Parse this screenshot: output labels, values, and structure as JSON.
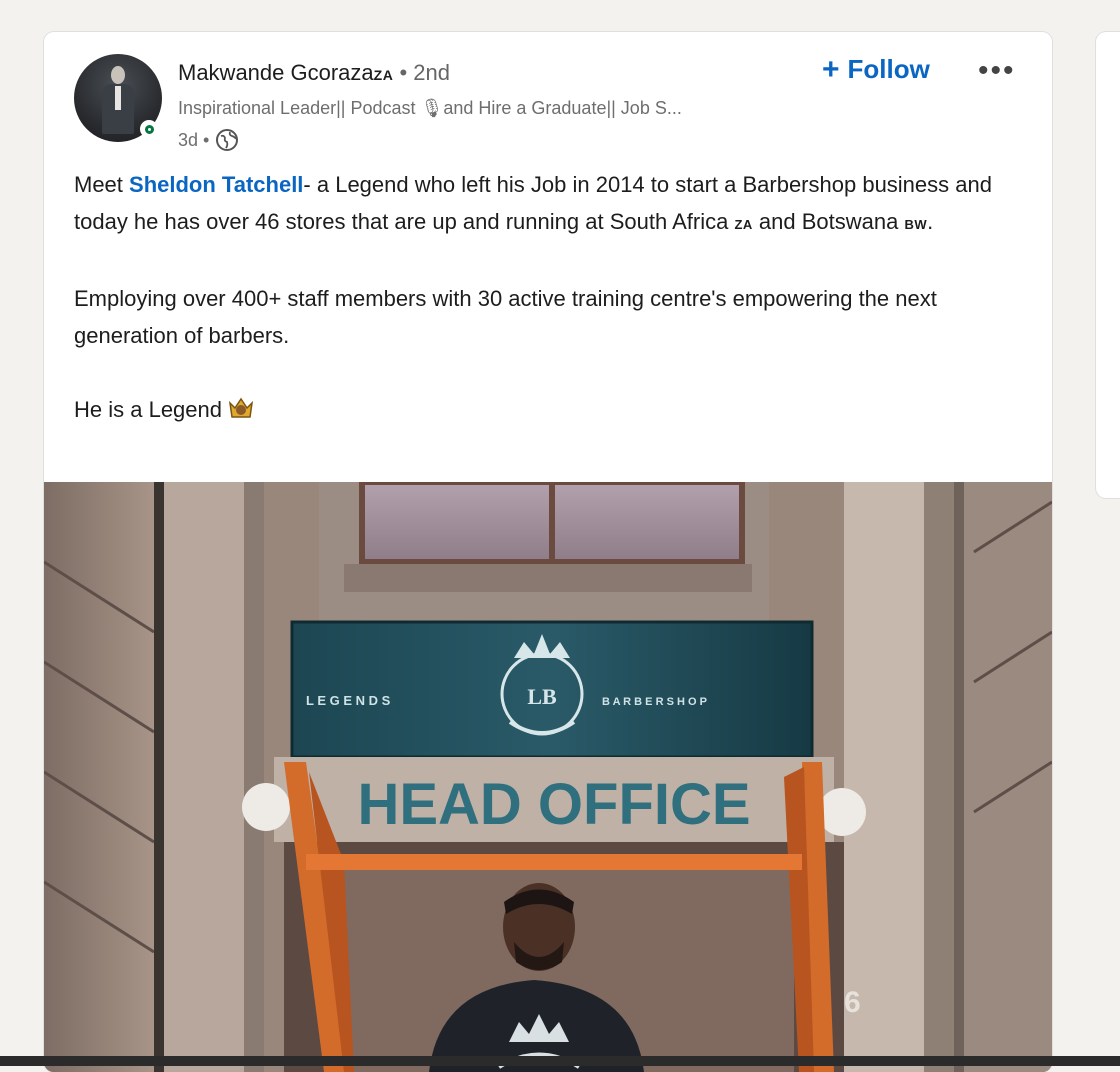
{
  "post": {
    "author": {
      "name": "Makwande Gcoraza",
      "name_suffix": "ZA",
      "separator": "•",
      "degree": "2nd",
      "headline": "Inspirational Leader|| Podcast 🎙and Hire a Graduate|| Job S...",
      "time": "3d •",
      "visibility_icon": "globe-icon",
      "presence": "online"
    },
    "follow_label": "Follow",
    "more_icon": "•••",
    "text": {
      "p1_pre": "Meet ",
      "p1_mention": "Sheldon Tatchell",
      "p1_mid": "- a Legend who left his Job in 2014 to start a Barbershop business and today he has over 46 stores that are up and running at South Africa ",
      "p1_flag1": "ZA",
      "p1_and": " and Botswana ",
      "p1_flag2": "BW",
      "p1_end": ".",
      "p2": "Employing over 400+ staff members with 30 active training centre's empowering the next generation of barbers.",
      "p3": "He is a Legend"
    },
    "image": {
      "sign_left": "L E G E N D S",
      "sign_right": "B A R B E R S H O P",
      "sign_logo": "LB",
      "head_office": "HEAD OFFICE",
      "door_number": "6"
    }
  },
  "colors": {
    "accent": "#0a66c2",
    "presence": "#057642",
    "sign": "#1f4a56",
    "head_office_text": "#2f6f7e"
  }
}
